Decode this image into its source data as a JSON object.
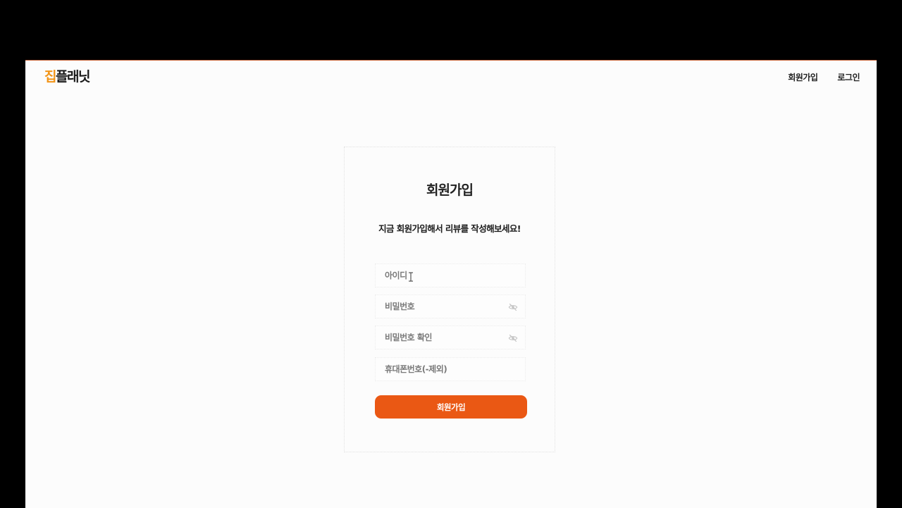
{
  "header": {
    "logo_accent": "집",
    "logo_rest": "플래닛",
    "nav": [
      {
        "label": "회원가입"
      },
      {
        "label": "로그인"
      }
    ]
  },
  "form": {
    "title": "회원가입",
    "subtitle": "지금 회원가입해서 리뷰를 작성해보세요!",
    "fields": {
      "id_placeholder": "아이디",
      "password_placeholder": "비밀번호",
      "password_confirm_placeholder": "비밀번호 확인",
      "phone_placeholder": "휴대폰번호(-제외)"
    },
    "submit_label": "회원가입"
  },
  "colors": {
    "accent": "#f29416",
    "button": "#ea5814"
  },
  "icons": [
    "eye-slash-icon",
    "text-cursor-icon"
  ]
}
